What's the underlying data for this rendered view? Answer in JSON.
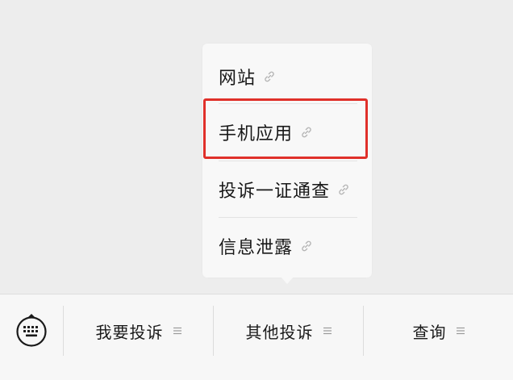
{
  "popup_menu": {
    "items": [
      {
        "label": "网站",
        "icon": "link-icon"
      },
      {
        "label": "手机应用",
        "icon": "link-icon"
      },
      {
        "label": "投诉一证通查",
        "icon": "link-icon"
      },
      {
        "label": "信息泄露",
        "icon": "link-icon"
      }
    ],
    "highlighted_index": 1,
    "highlight_color": "#e0302a"
  },
  "bottom_bar": {
    "keyboard_icon": "keyboard-icon",
    "tabs": [
      {
        "label": "我要投诉",
        "icon": "menu-lines-icon"
      },
      {
        "label": "其他投诉",
        "icon": "menu-lines-icon"
      },
      {
        "label": "查询",
        "icon": "menu-lines-icon"
      }
    ]
  }
}
